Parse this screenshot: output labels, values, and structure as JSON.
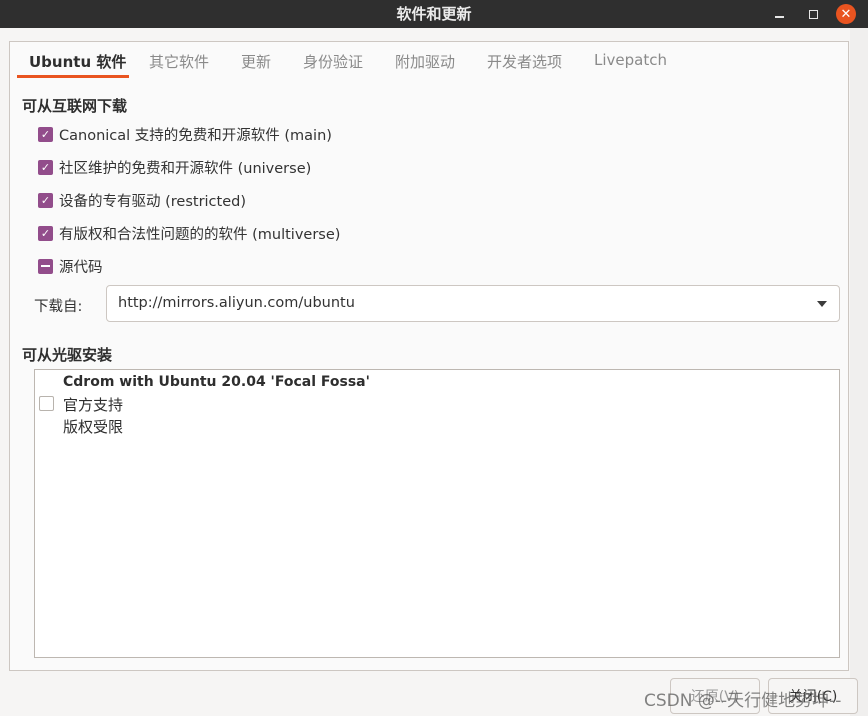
{
  "window": {
    "title": "软件和更新",
    "minimize_icon": "minimize-icon",
    "maximize_icon": "maximize-icon",
    "close_icon": "close-icon",
    "close_color": "#e95420"
  },
  "tabs": [
    {
      "label": "Ubuntu 软件",
      "active": true
    },
    {
      "label": "其它软件",
      "active": false
    },
    {
      "label": "更新",
      "active": false
    },
    {
      "label": "身份验证",
      "active": false
    },
    {
      "label": "附加驱动",
      "active": false
    },
    {
      "label": "开发者选项",
      "active": false
    },
    {
      "label": "Livepatch",
      "active": false
    }
  ],
  "internet": {
    "title": "可从互联网下载",
    "items": [
      {
        "label": "Canonical 支持的免费和开源软件 (main)",
        "state": "checked"
      },
      {
        "label": "社区维护的免费和开源软件 (universe)",
        "state": "checked"
      },
      {
        "label": "设备的专有驱动 (restricted)",
        "state": "checked"
      },
      {
        "label": "有版权和合法性问题的的软件 (multiverse)",
        "state": "checked"
      },
      {
        "label": "源代码",
        "state": "mixed"
      }
    ],
    "download_label": "下载自:",
    "download_value": "http://mirrors.aliyun.com/ubuntu"
  },
  "cdrom": {
    "title": "可从光驱安装",
    "entry_title": "Cdrom with Ubuntu 20.04 'Focal Fossa'",
    "line1": "官方支持",
    "line2": "版权受限",
    "checked": false
  },
  "footer": {
    "revert_label": "还原(V)",
    "close_label": "关闭(C)"
  },
  "watermark": "CSDN @--天行健地势坤--",
  "accent_color": "#e95420",
  "checkbox_color": "#924d8b"
}
